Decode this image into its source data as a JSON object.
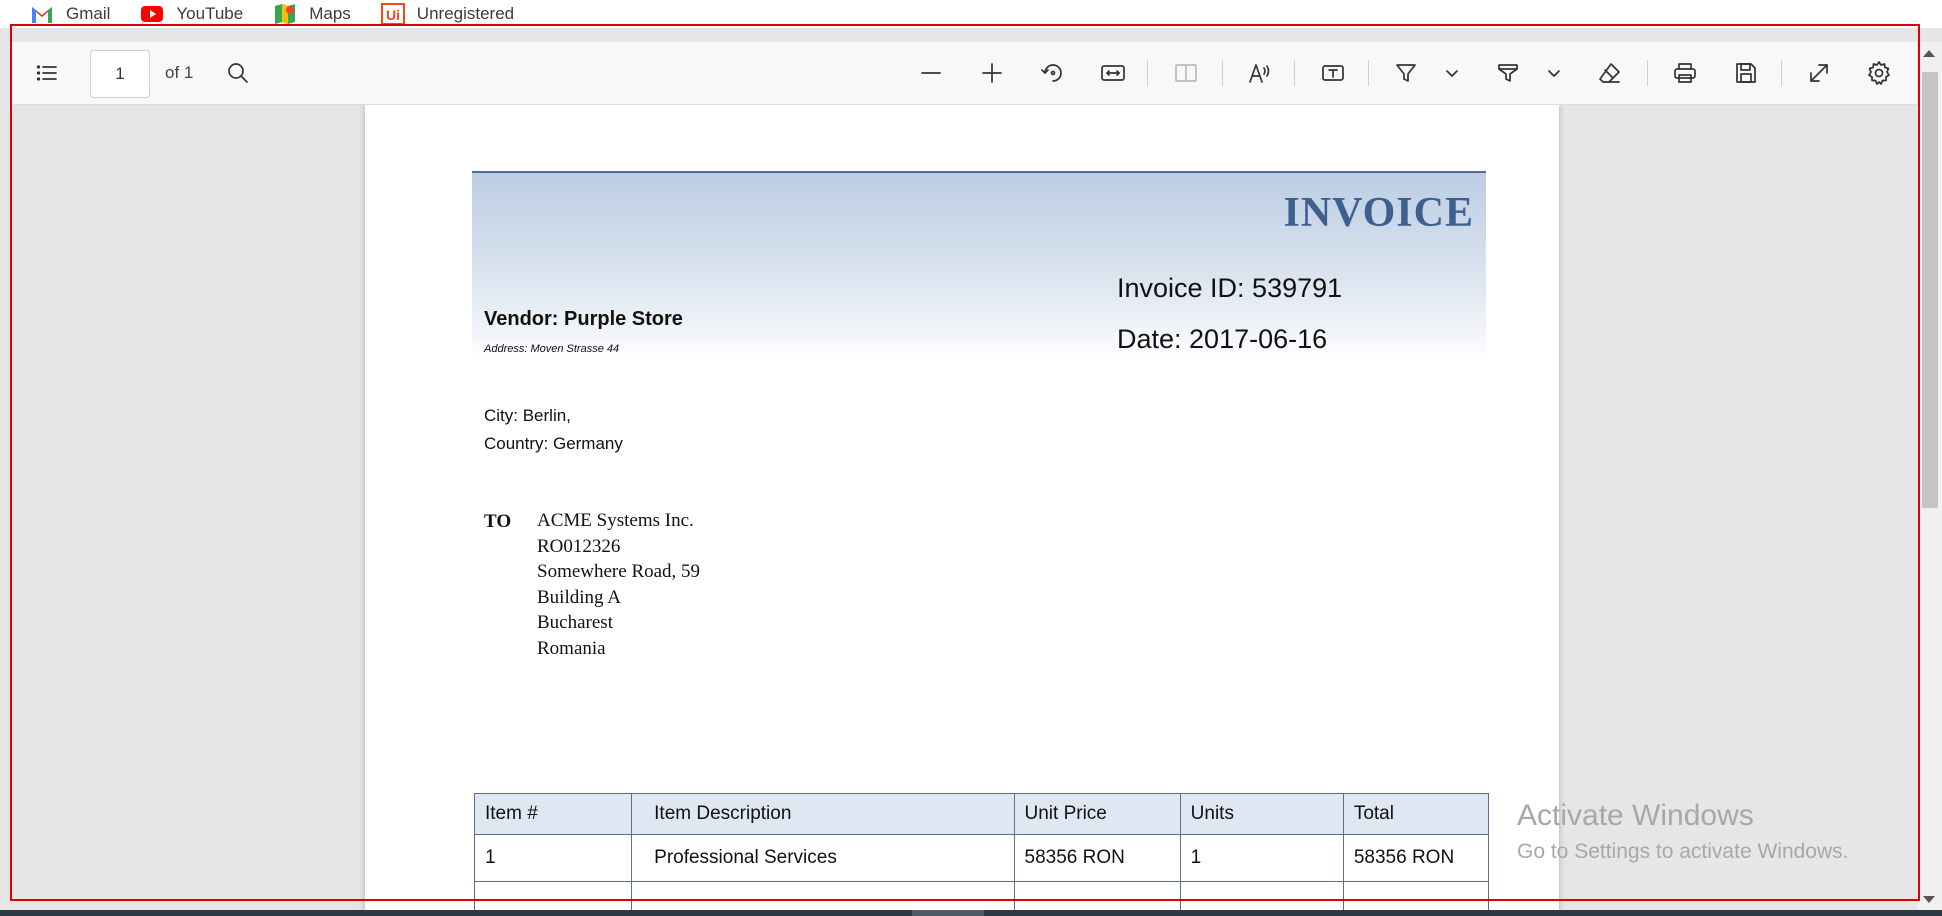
{
  "bookmarks": [
    {
      "label": "Gmail",
      "icon": "gmail-icon"
    },
    {
      "label": "YouTube",
      "icon": "youtube-icon"
    },
    {
      "label": "Maps",
      "icon": "maps-icon"
    },
    {
      "label": "Unregistered",
      "icon": "uipath-icon"
    }
  ],
  "toolbar": {
    "page_value": "1",
    "page_total_label": "of 1",
    "icons": [
      "list-icon",
      "search-icon",
      "zoom-out-icon",
      "zoom-in-icon",
      "rotate-icon",
      "fit-width-icon",
      "two-page-icon",
      "read-aloud-icon",
      "text-box-icon",
      "highlight-icon",
      "chevron-down-icon",
      "draw-icon",
      "chevron-down-icon",
      "eraser-icon",
      "print-icon",
      "save-icon",
      "fullscreen-icon",
      "settings-icon"
    ]
  },
  "invoice": {
    "title": "INVOICE",
    "invoice_id": "Invoice ID: 539791",
    "date": "Date: 2017-06-16",
    "vendor": "Vendor: Purple Store",
    "vendor_address": "Address: Moven Strasse 44",
    "city": "City: Berlin,",
    "country": "Country: Germany",
    "to_label": "TO",
    "to_lines": [
      "ACME Systems Inc.",
      "RO012326",
      "Somewhere Road, 59",
      "Building A",
      "Bucharest",
      "Romania"
    ],
    "table": {
      "headers": [
        "Item #",
        "Item Description",
        "Unit Price",
        "Units",
        "Total"
      ],
      "rows": [
        [
          "1",
          "Professional Services",
          "58356 RON",
          "1",
          "58356 RON"
        ]
      ]
    }
  },
  "watermark": {
    "line1": "Activate Windows",
    "line2": "Go to Settings to activate Windows."
  },
  "colors": {
    "accent": "#3f5f8f",
    "frame": "#e00000",
    "header_gradient_top": "#bccde3"
  }
}
